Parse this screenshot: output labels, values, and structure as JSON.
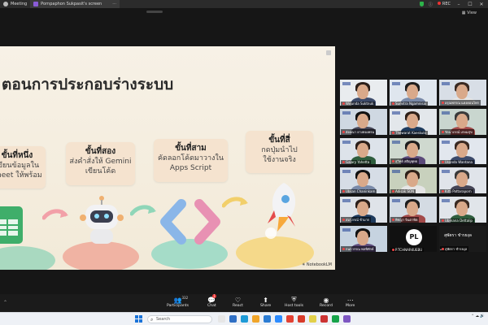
{
  "window": {
    "tabs": [
      {
        "label": "Meeting"
      },
      {
        "label": "Pornpaphon Sukpasit's screen"
      }
    ],
    "rec_label": "REC",
    "controls": {
      "minimize": "–",
      "maximize": "☐",
      "close": "✕"
    }
  },
  "view_button": "View",
  "slide": {
    "title": "ตอนการประกอบร่างระบบ",
    "steps": [
      {
        "head": "ขั้นที่หนึ่ง",
        "lines": [
          "เขียนข้อมูลใน",
          "Sheet ให้พร้อม"
        ]
      },
      {
        "head": "ขั้นที่สอง",
        "lines": [
          "ส่งคำสั่งให้ Gemini",
          "เขียนโค้ด"
        ]
      },
      {
        "head": "ขั้นที่สาม",
        "lines": [
          "คัดลอกโค้ดมาวางใน",
          "Apps Script"
        ]
      },
      {
        "head": "ขั้นที่สี่",
        "lines": [
          "กดปุ่มนำไป",
          "ใช้งานจริง"
        ]
      }
    ],
    "watermark": "NotebookLM"
  },
  "gallery": {
    "participants": [
      {
        "name": "Wirunda Suktnuk"
      },
      {
        "name": "Sumitra Ngamnisai"
      },
      {
        "name": "อรุณพรรณ แดงดอนไพร"
      },
      {
        "name": "อังคณา ยางทองพรม"
      },
      {
        "name": "Thewarat Kaeskulo"
      },
      {
        "name": "รัตนาภรณ์ เกษมสุข"
      },
      {
        "name": "Gaiary Yahetta"
      },
      {
        "name": "สุวิทย์ สติญพุทธ"
      },
      {
        "name": "Usanda Wantana"
      },
      {
        "name": "Ubsan Chaninkam"
      },
      {
        "name": "Adisak SON"
      },
      {
        "name": "Kitti Pattaraporn"
      },
      {
        "name": "สมาภรณ์ ช้ามาก"
      },
      {
        "name": "พิชญา จินตาทิต"
      },
      {
        "name": "Ubmana Dettalip"
      },
      {
        "name": "กนกวรรณ พลพิทักษ์"
      },
      {
        "name": "P.TCHNARKUEBU"
      },
      {
        "name": "สุพัตรา ชำรยงุล"
      }
    ],
    "speaker_large_name": "สุพัตรา ชำรยงุล",
    "more_label": "⌄"
  },
  "toolbar": {
    "items": [
      {
        "label": "Participants",
        "count": "332"
      },
      {
        "label": "Chat",
        "badge": "1"
      },
      {
        "label": "React"
      },
      {
        "label": "Share"
      },
      {
        "label": "Host tools"
      },
      {
        "label": "Record"
      },
      {
        "label": "More"
      }
    ]
  },
  "taskbar": {
    "search_placeholder": "Search"
  },
  "colors": {
    "accent": "#1a73d9",
    "rec": "#ee3333",
    "slide_bg": "#f5eee0"
  }
}
